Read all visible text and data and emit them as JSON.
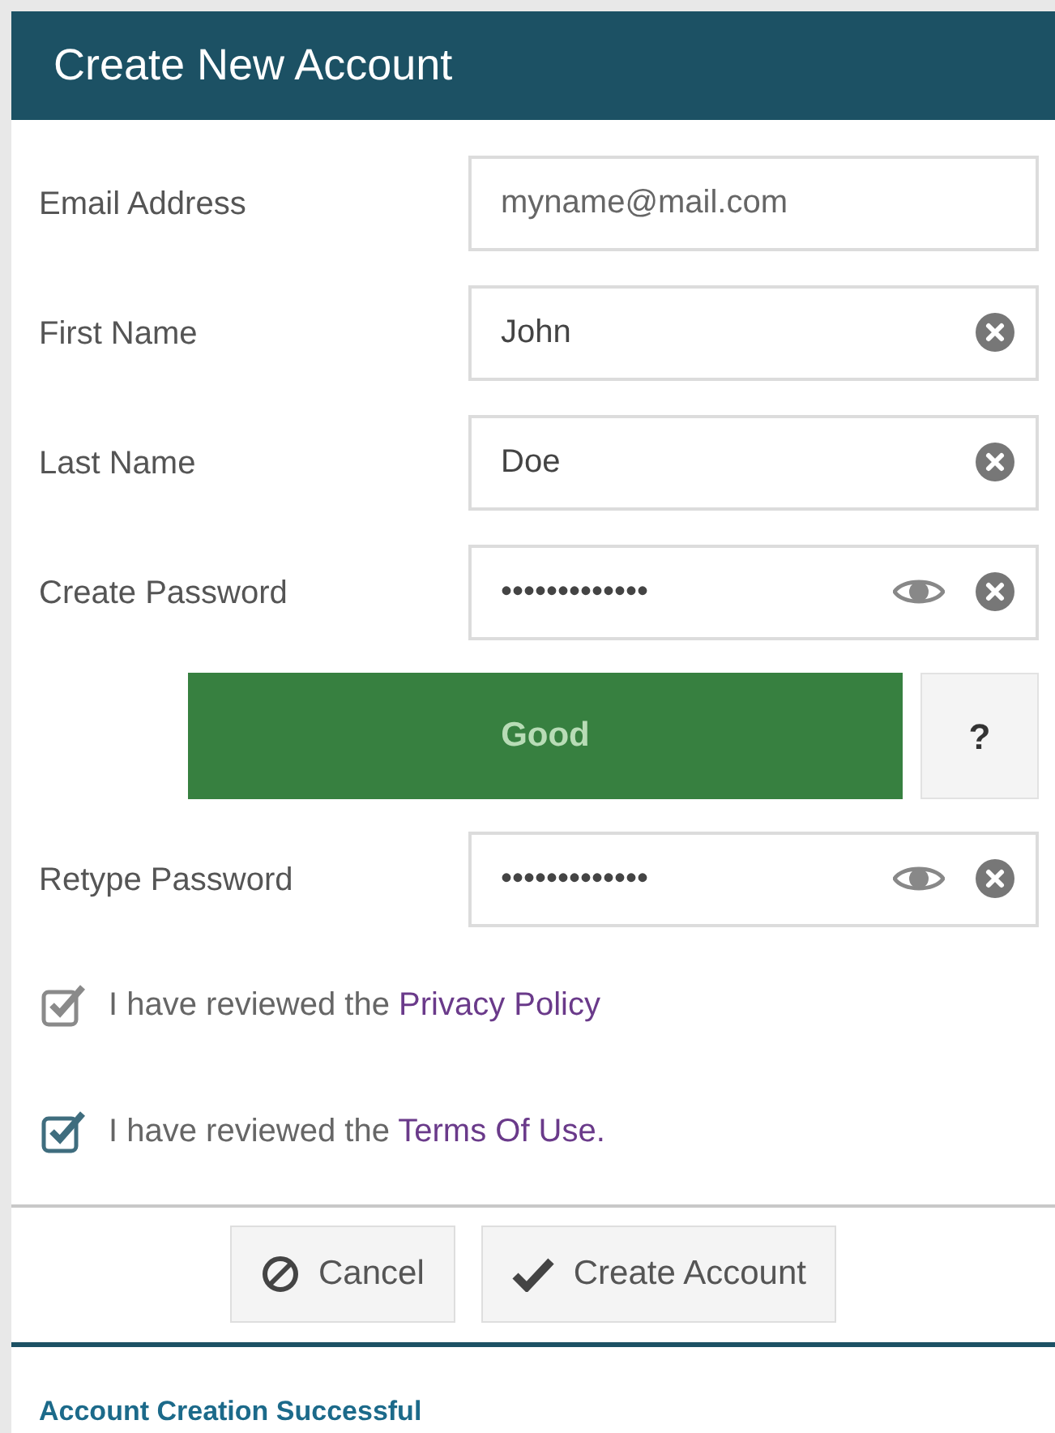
{
  "window": {
    "title": "Create New Account"
  },
  "fields": [
    {
      "label": "Email Address",
      "kind": "email",
      "placeholder": "myname@mail.com"
    },
    {
      "label": "First Name",
      "kind": "text",
      "value": "John"
    },
    {
      "label": "Last Name",
      "kind": "text",
      "value": "Doe"
    },
    {
      "label": "Create Password",
      "kind": "password",
      "value": "•••••••••••••"
    },
    {
      "label": "Good",
      "kind": "strength",
      "help": "?"
    },
    {
      "label": "Retype Password",
      "kind": "password",
      "value": "•••••••••••••"
    }
  ],
  "agreements": [
    {
      "text": "I have reviewed the",
      "link": "Privacy Policy",
      "checked": true,
      "focused": false
    },
    {
      "text": "I have reviewed the",
      "link": "Terms Of Use.",
      "checked": true,
      "focused": true
    }
  ],
  "buttons": [
    {
      "label": "Cancel",
      "kind": "cancel"
    },
    {
      "label": "Create Account",
      "kind": "confirm"
    }
  ],
  "status": "Account Creation Successful"
}
